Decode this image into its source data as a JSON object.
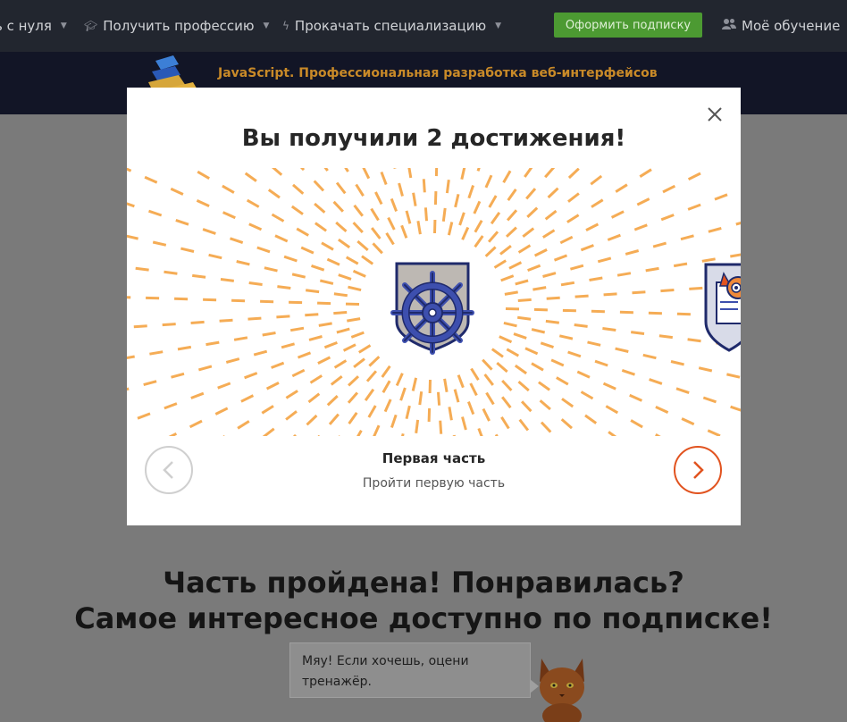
{
  "nav": {
    "items": [
      {
        "label": "ь с нуля",
        "icon": ""
      },
      {
        "label": "Получить профессию",
        "icon": "mortarboard-icon"
      },
      {
        "label": "Прокачать специализацию",
        "icon": "lightning-icon"
      }
    ],
    "subscribe_label": "Оформить подписку",
    "my_learning_label": "Моё обучение",
    "my_learning_icon": "users-icon"
  },
  "course": {
    "title": "JavaScript. Профессиональная разработка веб-интерфейсов"
  },
  "modal": {
    "title": "Вы получили 2 достижения!",
    "achievement": {
      "name": "Первая часть",
      "description": "Пройти первую часть",
      "icon": "ship-wheel-badge-icon"
    },
    "next_badge_icon": "cat-document-badge-icon",
    "prev_icon": "chevron-left-icon",
    "next_icon": "chevron-right-icon",
    "close_icon": "close-icon"
  },
  "page": {
    "headline_line1": "Часть пройдена! Понравилась?",
    "headline_line2": "Самое интересное доступно по подписке!",
    "bubble_text": "Мяу! Если хочешь, оцени тренажёр."
  },
  "colors": {
    "accent": "#e1531f",
    "burst": "#f5ac55",
    "subscribe": "#4c9a32",
    "badge_navy": "#1f2a6b",
    "badge_blue": "#3d4fae"
  }
}
